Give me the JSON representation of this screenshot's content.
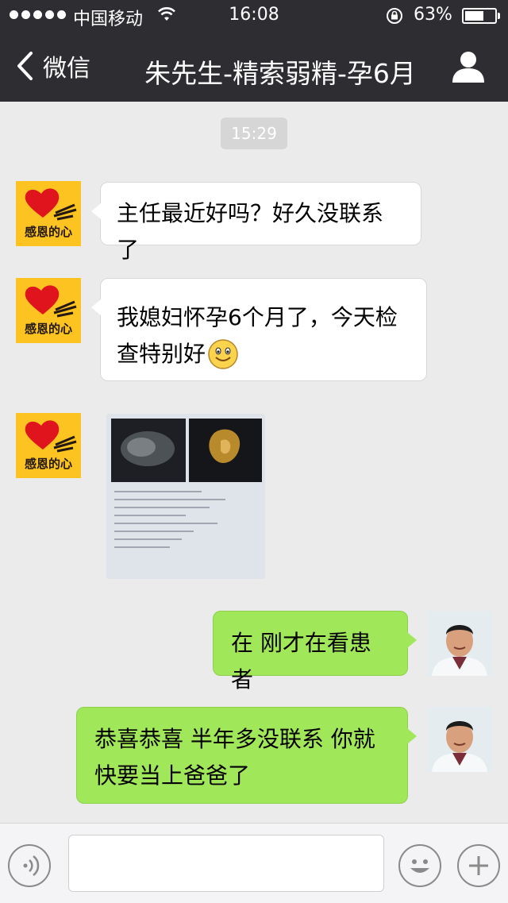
{
  "status_bar": {
    "carrier": "中国移动",
    "time": "16:08",
    "battery_percent": "63%",
    "battery_level": 0.63
  },
  "nav": {
    "back_label": "微信",
    "title": "朱先生-精索弱精-孕6月"
  },
  "chat": {
    "timestamp": "15:29",
    "messages": [
      {
        "side": "left",
        "sender": "patient",
        "avatar_text": "感恩的心",
        "line1": "主任最近好吗？好久没联系了"
      },
      {
        "side": "left",
        "sender": "patient",
        "avatar_text": "感恩的心",
        "line1": "我媳妇怀孕6个月了，今天检",
        "line2": "查特别好",
        "emoji": "smiley"
      },
      {
        "side": "left",
        "sender": "patient",
        "avatar_text": "感恩的心",
        "type": "image",
        "description": "ultrasound-report-photo"
      },
      {
        "side": "right",
        "sender": "doctor",
        "line1": "在 刚才在看患者"
      },
      {
        "side": "right",
        "sender": "doctor",
        "line1": "恭喜恭喜 半年多没联系 你就",
        "line2": "快要当上爸爸了"
      }
    ]
  },
  "input_bar": {
    "voice_icon": "voice-icon",
    "emoji_icon": "emoji-icon",
    "plus_icon": "plus-icon",
    "text_value": ""
  },
  "colors": {
    "nav_bg": "#2e2d32",
    "chat_bg": "#ebebeb",
    "bubble_right": "#a0e75a",
    "bubble_left": "#ffffff",
    "avatar_yellow": "#fcc321"
  }
}
